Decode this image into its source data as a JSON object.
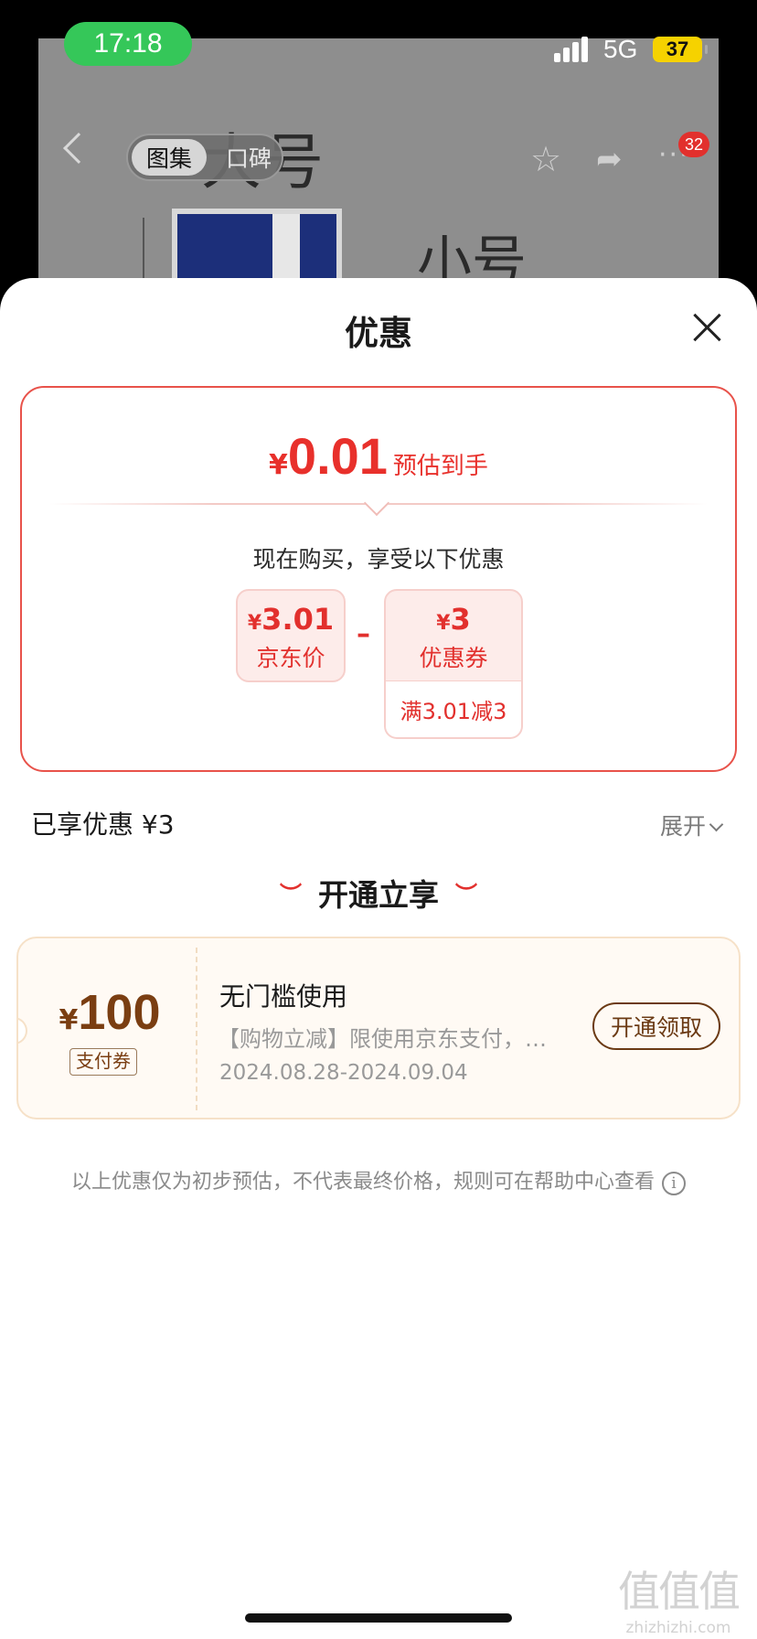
{
  "status": {
    "time": "17:18",
    "network": "5G",
    "battery": "37"
  },
  "background_page": {
    "segment_tabs": [
      "图集",
      "口碑"
    ],
    "big_text": "大号",
    "small_text": "小号",
    "badge_count": "32"
  },
  "sheet": {
    "title": "优惠",
    "estimate": {
      "currency": "¥",
      "amount": "0.01",
      "label": "预估到手"
    },
    "subtitle": "现在购买，享受以下优惠",
    "jd_price": {
      "currency": "¥",
      "amount": "3.01",
      "label": "京东价"
    },
    "coupon_discount": {
      "currency": "¥",
      "amount": "3",
      "label": "优惠券",
      "rule": "满3.01减3"
    },
    "operator": "–",
    "enjoyed": "已享优惠 ¥3",
    "expand_label": "展开",
    "open_section_title": "开通立享",
    "open_coupon": {
      "currency": "¥",
      "amount": "100",
      "type": "支付券",
      "title": "无门槛使用",
      "desc": "【购物立减】限使用京东支付，…",
      "date": "2024.08.28-2024.09.04",
      "button": "开通领取"
    },
    "footnote": "以上优惠仅为初步预估，不代表最终价格，规则可在帮助中心查看"
  },
  "watermark": {
    "chars": "值值值",
    "domain": "zhizhizhi.com"
  },
  "colors": {
    "accent": "#e2302d",
    "coupon_brown": "#6b3a14",
    "status_green": "#35c759"
  }
}
